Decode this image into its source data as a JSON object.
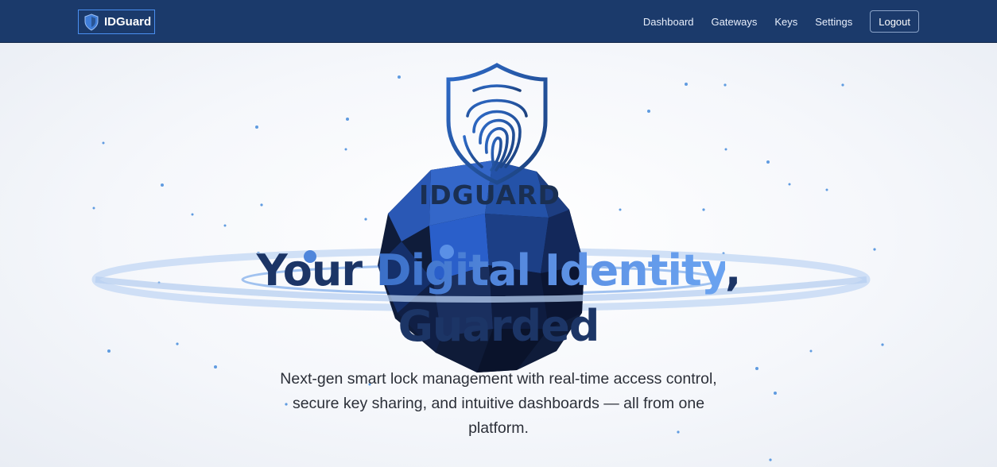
{
  "nav": {
    "brand": "IDGuard",
    "links": [
      "Dashboard",
      "Gateways",
      "Keys",
      "Settings"
    ],
    "logout": "Logout"
  },
  "hero": {
    "wordmark": "IDGUARD",
    "title_line1_a": "Your ",
    "title_line1_b": "Digital Identity",
    "title_line1_c": ",",
    "title_line2": "Guarded",
    "subtitle": "Next-gen smart lock management with real-time access control, secure key sharing, and intuitive dashboards — all from one platform.",
    "cta_primary": "",
    "cta_secondary": ""
  },
  "icons": {
    "brand": "shield-fingerprint-icon",
    "hero_logo": "shield-fingerprint-icon",
    "globe": "low-poly-globe"
  },
  "colors": {
    "navbar": "#1b3a6b",
    "accent": "#4a8ff0",
    "title_dark": "#1c3566",
    "title_accent": "#5b8fe3"
  }
}
